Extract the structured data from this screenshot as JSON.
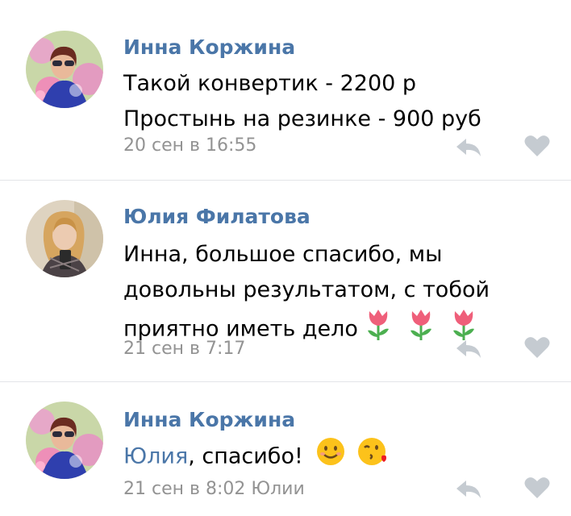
{
  "comments": [
    {
      "author": "Инна Коржина",
      "lines": [
        "Такой конвертик - 2200 р",
        "Простынь на резинке - 900 руб"
      ],
      "meta": "20 сен в 16:55",
      "avatar": "woman-with-pink-flowers"
    },
    {
      "author": "Юлия Филатова",
      "lines": [
        "Инна, большое спасибо, мы",
        "довольны результатом, с тобой",
        "приятно иметь дело"
      ],
      "emoji": [
        "tulip",
        "tulip",
        "tulip"
      ],
      "meta": "21 сен в 7:17",
      "avatar": "woman-taking-mirror-selfie"
    },
    {
      "author": "Инна Коржина",
      "mention": "Юлия",
      "text_after_mention": ", спасибо!",
      "emoji": [
        "smiling-face",
        "face-blowing-kiss"
      ],
      "meta": "21 сен в 8:02 Юлии",
      "avatar": "woman-with-pink-flowers"
    }
  ],
  "icons": {
    "reply": "reply-arrow-icon",
    "like": "heart-icon"
  },
  "colors": {
    "link": "#4a76a8",
    "meta": "#939393",
    "icon": "#c5cbd1",
    "divider": "#e3e4e8"
  }
}
